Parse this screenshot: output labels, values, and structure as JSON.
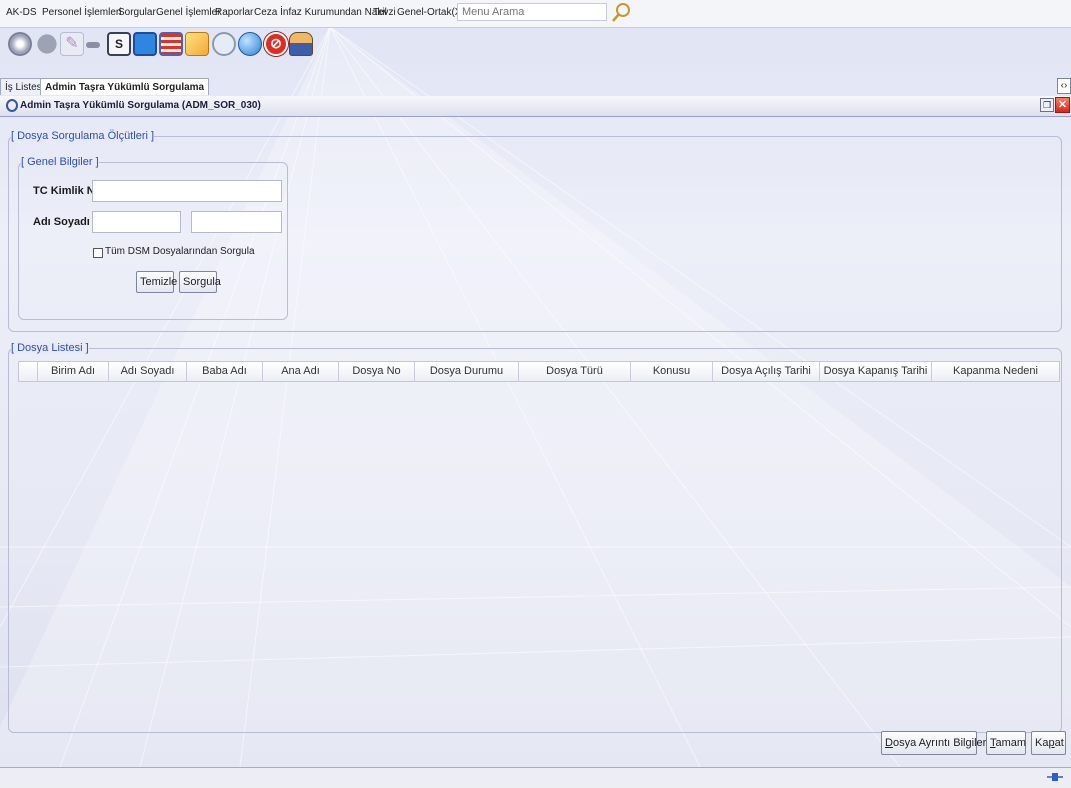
{
  "menu": {
    "items": [
      "AK-DS",
      "Personel İşlemleri",
      "Sorgular",
      "Genel İşlemler",
      "Raporlar",
      "Ceza İnfaz Kurumundan Nakil",
      "Tevzi",
      "Genel-Ortak(X)"
    ],
    "search_placeholder": "Menu Arama"
  },
  "toolbar": {
    "icons": [
      "disk-icon",
      "record-icon",
      "pen-icon",
      "minus-icon",
      "report-s-icon",
      "chart-icon",
      "list-icon",
      "search-doc-icon",
      "stethoscope-icon",
      "info-globe-icon",
      "forbidden-icon",
      "user-icon"
    ]
  },
  "tabs": [
    {
      "label": "İş Listesi"
    },
    {
      "label": "Admin Taşra Yükümlü Sorgulama"
    }
  ],
  "tab_scroll_label": "‹›",
  "window": {
    "title": "Admin Taşra Yükümlü Sorgulama (ADM_SOR_030)"
  },
  "criteria": {
    "legend": "[ Dosya Sorgulama Ölçütleri ]",
    "general_legend": "[ Genel Bilgiler ]",
    "tc_label": "TC Kimlik No",
    "tc_value": "",
    "name_label": "Adı Soyadı",
    "first_name_value": "",
    "last_name_value": "",
    "all_dsm_label": "Tüm DSM Dosyalarından Sorgula",
    "all_dsm_checked": false,
    "clear_button": "Temizle",
    "query_button": "Sorgula"
  },
  "list": {
    "legend": "[ Dosya Listesi ]",
    "columns": [
      "Birim Adı",
      "Adı Soyadı",
      "Baba Adı",
      "Ana Adı",
      "Dosya No",
      "Dosya Durumu",
      "Dosya Türü",
      "Konusu",
      "Dosya Açılış Tarihi",
      "Dosya Kapanış Tarihi",
      "Kapanma Nedeni"
    ],
    "rows": []
  },
  "footer": {
    "details_button": "Dosya Ayrıntı Bilgileri",
    "ok_button": "Tamam",
    "close_button": "Kapat"
  },
  "colors": {
    "legend": "#2a4fb5",
    "close": "#d4261a",
    "background": "#e6e8f4"
  }
}
